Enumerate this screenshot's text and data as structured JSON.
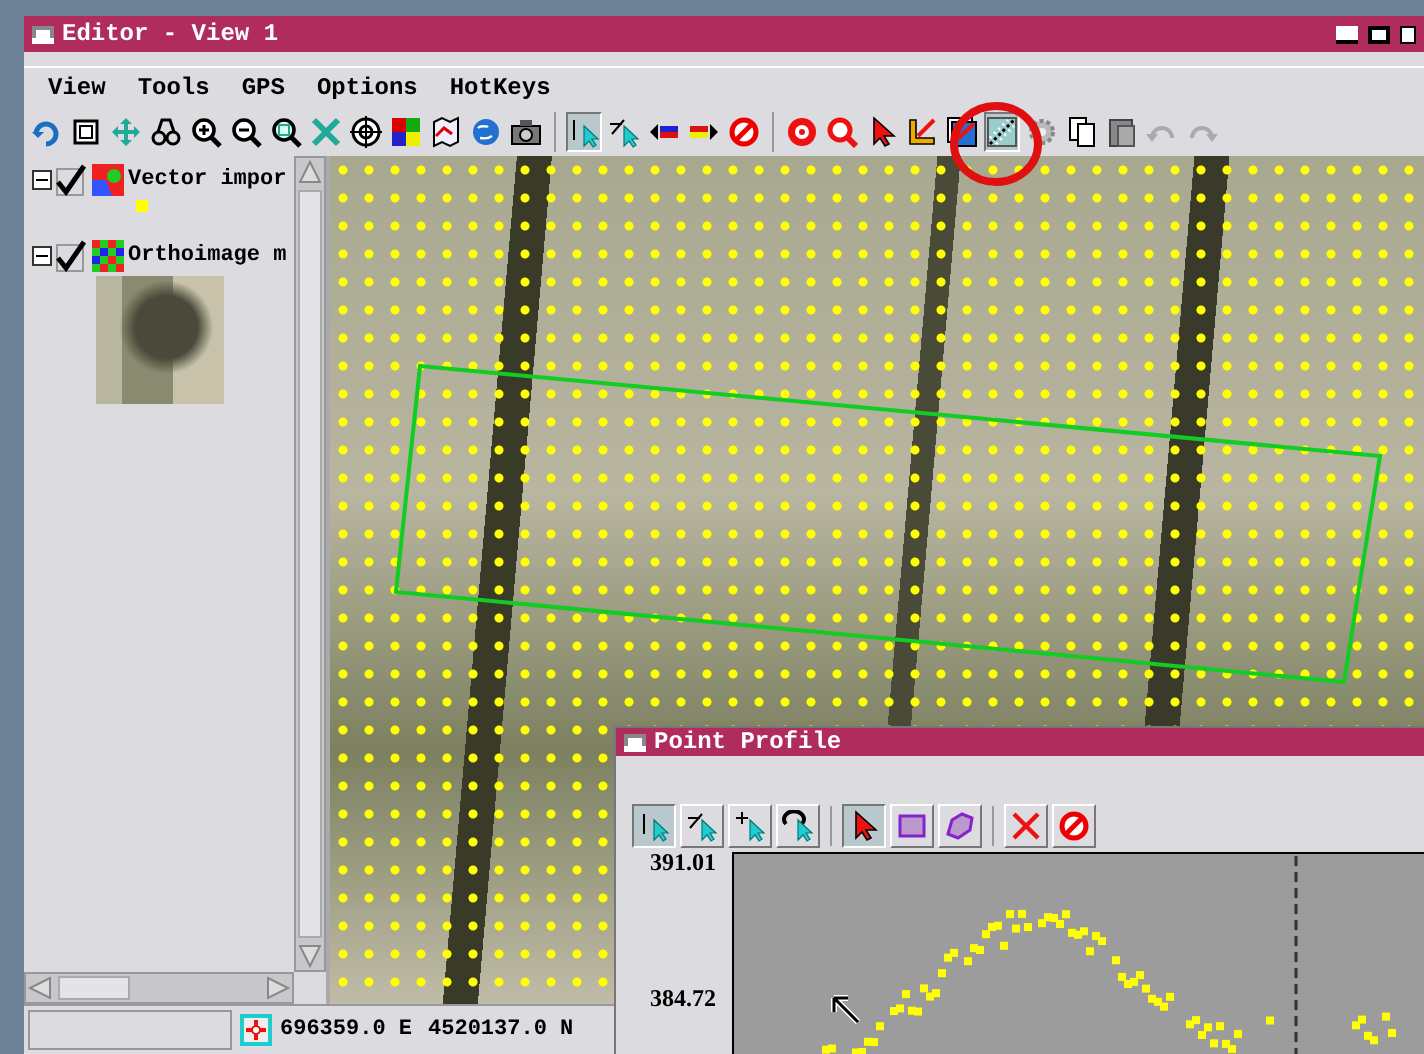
{
  "window": {
    "title": "Editor - View 1"
  },
  "menu": [
    "View",
    "Tools",
    "GPS",
    "Options",
    "HotKeys"
  ],
  "toolbar": [
    {
      "kind": "rotate",
      "selected": false
    },
    {
      "kind": "square",
      "selected": false
    },
    {
      "kind": "pan",
      "selected": false
    },
    {
      "kind": "binoculars",
      "selected": false
    },
    {
      "kind": "zoom-in",
      "selected": false
    },
    {
      "kind": "zoom-out",
      "selected": false
    },
    {
      "kind": "zoom-box",
      "selected": false
    },
    {
      "kind": "fit",
      "selected": false
    },
    {
      "kind": "target",
      "selected": false
    },
    {
      "kind": "colors",
      "selected": false
    },
    {
      "kind": "map",
      "selected": false
    },
    {
      "kind": "globe",
      "selected": false
    },
    {
      "kind": "camera",
      "selected": false
    },
    {
      "kind": "sep"
    },
    {
      "kind": "select-one",
      "selected": true
    },
    {
      "kind": "select-minus",
      "selected": false
    },
    {
      "kind": "move-left",
      "selected": false
    },
    {
      "kind": "move-right",
      "selected": false
    },
    {
      "kind": "cancel",
      "selected": false
    },
    {
      "kind": "sep"
    },
    {
      "kind": "target-red",
      "selected": false
    },
    {
      "kind": "zoom-red",
      "selected": false
    },
    {
      "kind": "pointer",
      "selected": false
    },
    {
      "kind": "ruler",
      "selected": false
    },
    {
      "kind": "layers",
      "selected": false
    },
    {
      "kind": "points",
      "selected": true
    },
    {
      "kind": "gear",
      "selected": false
    },
    {
      "kind": "copy",
      "selected": false
    },
    {
      "kind": "paste",
      "selected": false
    },
    {
      "kind": "undo",
      "selected": false
    },
    {
      "kind": "redo",
      "selected": false
    }
  ],
  "layers": [
    {
      "label": "Vector impor",
      "kind": "vector",
      "expanded": true,
      "checked": true
    },
    {
      "label": "Orthoimage m",
      "kind": "raster",
      "expanded": true,
      "checked": true
    }
  ],
  "status_bar": {
    "easting": "696359.0 E",
    "northing": "4520137.0 N"
  },
  "profile": {
    "title": "Point Profile",
    "toolbar": [
      {
        "kind": "select-one",
        "selected": true
      },
      {
        "kind": "select-minus",
        "selected": false
      },
      {
        "kind": "select-plus",
        "selected": false
      },
      {
        "kind": "select-undo",
        "selected": false
      },
      {
        "kind": "sep"
      },
      {
        "kind": "pointer",
        "selected": true
      },
      {
        "kind": "rectangle",
        "selected": false
      },
      {
        "kind": "polygon",
        "selected": false
      },
      {
        "kind": "sep"
      },
      {
        "kind": "delete",
        "selected": false
      },
      {
        "kind": "cancel",
        "selected": false
      }
    ],
    "y_labels": [
      "391.01",
      "384.72"
    ]
  }
}
